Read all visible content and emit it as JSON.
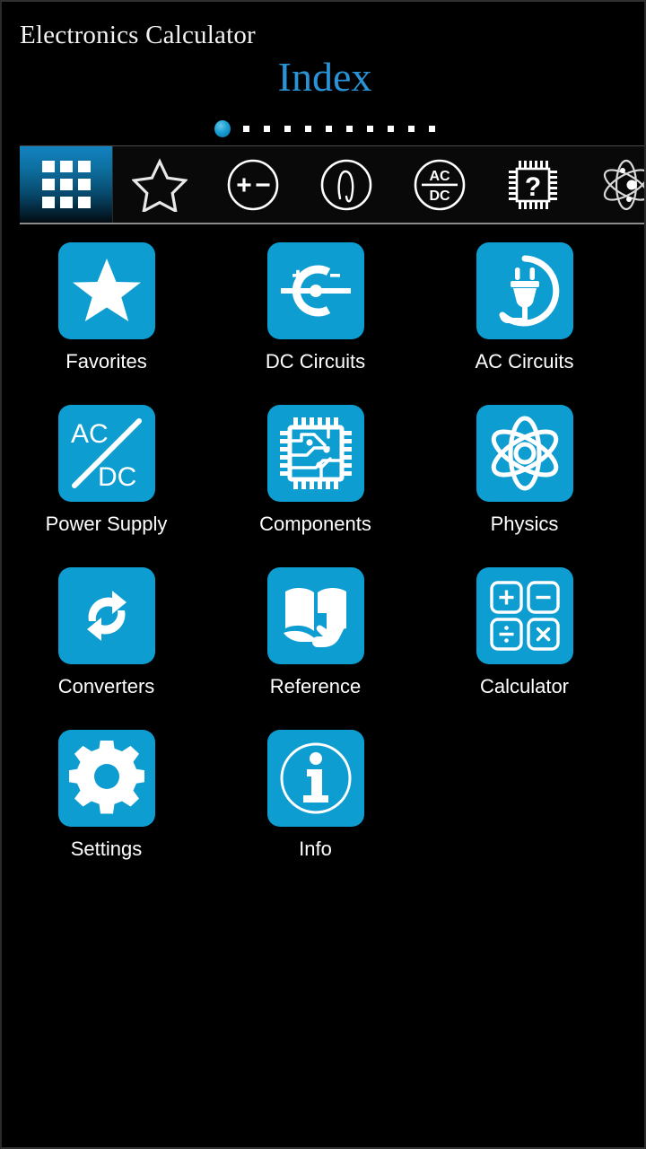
{
  "app": {
    "title": "Electronics Calculator",
    "page_title": "Index",
    "background_color": "#000000",
    "accent_color": "#0e9dd0",
    "title_color": "#2a93d5"
  },
  "pager": {
    "total_pages": 11,
    "current_page": 1,
    "active_dot_color": "#1a9ed4",
    "dot_color": "#ffffff"
  },
  "tabs": [
    {
      "id": "index",
      "icon": "grid-icon",
      "label": "Index",
      "selected": true
    },
    {
      "id": "favorites",
      "icon": "star-icon",
      "label": "Favorites",
      "selected": false
    },
    {
      "id": "dc",
      "icon": "plus-minus-circle-icon",
      "label": "DC Circuits",
      "selected": false
    },
    {
      "id": "ac",
      "icon": "sine-wave-circle-icon",
      "label": "AC Circuits",
      "selected": false
    },
    {
      "id": "acdc",
      "icon": "ac-dc-circle-icon",
      "label": "Power Supply",
      "selected": false
    },
    {
      "id": "components",
      "icon": "chip-question-icon",
      "label": "Components",
      "selected": false
    },
    {
      "id": "physics",
      "icon": "atom-icon",
      "label": "Physics",
      "selected": false
    }
  ],
  "tiles": [
    {
      "id": "favorites",
      "label": "Favorites",
      "icon": "star-icon"
    },
    {
      "id": "dc-circuits",
      "label": "DC Circuits",
      "icon": "dc-source-icon"
    },
    {
      "id": "ac-circuits",
      "label": "AC Circuits",
      "icon": "plug-circle-icon"
    },
    {
      "id": "power-supply",
      "label": "Power Supply",
      "icon": "ac-dc-icon"
    },
    {
      "id": "components",
      "label": "Components",
      "icon": "chip-icon"
    },
    {
      "id": "physics",
      "label": "Physics",
      "icon": "atom-icon"
    },
    {
      "id": "converters",
      "label": "Converters",
      "icon": "convert-arrows-icon"
    },
    {
      "id": "reference",
      "label": "Reference",
      "icon": "book-hand-icon"
    },
    {
      "id": "calculator",
      "label": "Calculator",
      "icon": "calculator-keys-icon"
    },
    {
      "id": "settings",
      "label": "Settings",
      "icon": "gear-icon"
    },
    {
      "id": "info",
      "label": "Info",
      "icon": "info-circle-icon"
    }
  ]
}
